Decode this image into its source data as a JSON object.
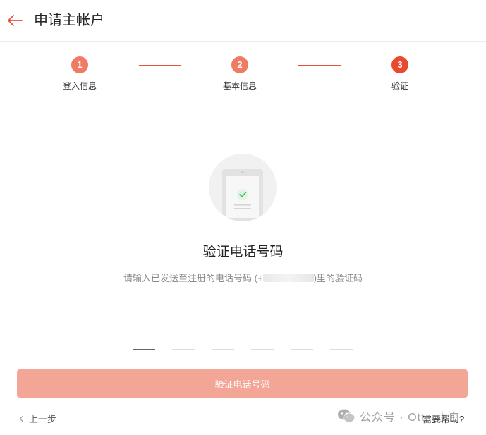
{
  "header": {
    "title": "申请主帐户",
    "back_icon": "arrow-left-icon"
  },
  "colors": {
    "accent": "#e84c3d",
    "step_done": "#f07a62",
    "step_active": "#e8492f",
    "button_disabled": "#f4a696"
  },
  "steps": [
    {
      "number": "1",
      "label": "登入信息"
    },
    {
      "number": "2",
      "label": "基本信息"
    },
    {
      "number": "3",
      "label": "验证"
    }
  ],
  "verify": {
    "title": "验证电话号码",
    "desc_prefix": "请输入已发送至注册的电话号码 (+",
    "desc_suffix": ")里的验证码"
  },
  "code": {
    "length": 6,
    "values": [
      "",
      "",
      "",
      "",
      "",
      ""
    ]
  },
  "actions": {
    "verify_button": "验证电话号码",
    "prev_label": "上一步",
    "help_label": "需要帮助?"
  },
  "watermark": {
    "text": "公众号 · Otter小白"
  }
}
